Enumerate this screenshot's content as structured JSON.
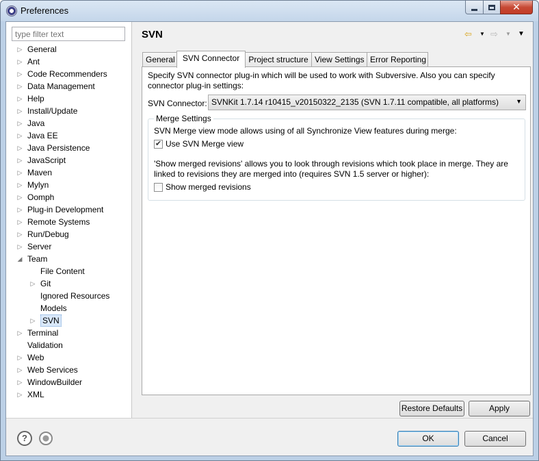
{
  "window": {
    "title": "Preferences"
  },
  "filter": {
    "placeholder": "type filter text"
  },
  "tree": {
    "items": [
      {
        "label": "General",
        "expander": "collapsed",
        "indent": 0
      },
      {
        "label": "Ant",
        "expander": "collapsed",
        "indent": 0
      },
      {
        "label": "Code Recommenders",
        "expander": "collapsed",
        "indent": 0
      },
      {
        "label": "Data Management",
        "expander": "collapsed",
        "indent": 0
      },
      {
        "label": "Help",
        "expander": "collapsed",
        "indent": 0
      },
      {
        "label": "Install/Update",
        "expander": "collapsed",
        "indent": 0
      },
      {
        "label": "Java",
        "expander": "collapsed",
        "indent": 0
      },
      {
        "label": "Java EE",
        "expander": "collapsed",
        "indent": 0
      },
      {
        "label": "Java Persistence",
        "expander": "collapsed",
        "indent": 0
      },
      {
        "label": "JavaScript",
        "expander": "collapsed",
        "indent": 0
      },
      {
        "label": "Maven",
        "expander": "collapsed",
        "indent": 0
      },
      {
        "label": "Mylyn",
        "expander": "collapsed",
        "indent": 0
      },
      {
        "label": "Oomph",
        "expander": "collapsed",
        "indent": 0
      },
      {
        "label": "Plug-in Development",
        "expander": "collapsed",
        "indent": 0
      },
      {
        "label": "Remote Systems",
        "expander": "collapsed",
        "indent": 0
      },
      {
        "label": "Run/Debug",
        "expander": "collapsed",
        "indent": 0
      },
      {
        "label": "Server",
        "expander": "collapsed",
        "indent": 0
      },
      {
        "label": "Team",
        "expander": "expanded",
        "indent": 0
      },
      {
        "label": "File Content",
        "expander": "none",
        "indent": 1
      },
      {
        "label": "Git",
        "expander": "collapsed",
        "indent": 1
      },
      {
        "label": "Ignored Resources",
        "expander": "none",
        "indent": 1
      },
      {
        "label": "Models",
        "expander": "none",
        "indent": 1
      },
      {
        "label": "SVN",
        "expander": "collapsed",
        "indent": 1,
        "selected": true
      },
      {
        "label": "Terminal",
        "expander": "collapsed",
        "indent": 0
      },
      {
        "label": "Validation",
        "expander": "none",
        "indent": 0
      },
      {
        "label": "Web",
        "expander": "collapsed",
        "indent": 0
      },
      {
        "label": "Web Services",
        "expander": "collapsed",
        "indent": 0
      },
      {
        "label": "WindowBuilder",
        "expander": "collapsed",
        "indent": 0
      },
      {
        "label": "XML",
        "expander": "collapsed",
        "indent": 0
      }
    ]
  },
  "page": {
    "title": "SVN"
  },
  "tabs": [
    {
      "label": "General",
      "active": false
    },
    {
      "label": "SVN Connector",
      "active": true
    },
    {
      "label": "Project structure",
      "active": false
    },
    {
      "label": "View Settings",
      "active": false
    },
    {
      "label": "Error Reporting",
      "active": false
    }
  ],
  "connector": {
    "description": "Specify SVN connector plug-in which will be used to work with Subversive. Also you can specify connector plug-in settings:",
    "label": "SVN Connector:",
    "selected_value": "SVNKit 1.7.14 r10415_v20150322_2135 (SVN 1.7.11 compatible, all platforms)"
  },
  "merge": {
    "group_title": "Merge Settings",
    "view_mode_text": "SVN Merge view mode allows using of all Synchronize View features during merge:",
    "use_merge_view_label": "Use SVN Merge view",
    "use_merge_view_checked": true,
    "show_revisions_text": "'Show merged revisions' allows you to look through revisions which took place in merge. They are linked to revisions they are merged into (requires SVN 1.5 server or higher):",
    "show_revisions_label": "Show merged revisions",
    "show_revisions_checked": false
  },
  "buttons": {
    "restore_defaults": "Restore Defaults",
    "apply": "Apply",
    "ok": "OK",
    "cancel": "Cancel"
  },
  "icons": {
    "back": "back-arrow-icon",
    "forward": "forward-arrow-icon",
    "menu": "view-menu-icon",
    "help": "help-icon",
    "import_export": "import-export-icon"
  }
}
